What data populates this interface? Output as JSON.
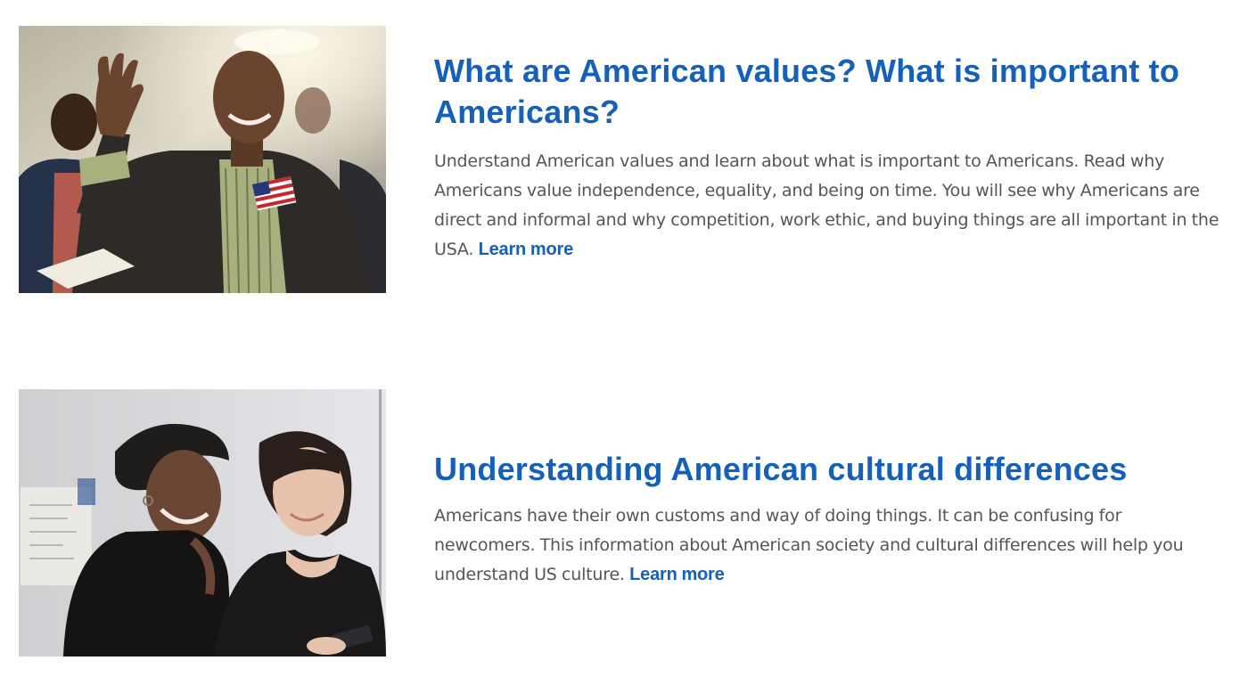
{
  "articles": [
    {
      "title": "What are American values? What is important to Americans?",
      "description": "Understand American values and learn about what is important to Americans. Read why Americans value independence, equality, and being on time. You will see why Americans are direct and informal and why competition, work ethic, and buying things are all important in the USA.",
      "link_label": "Learn more",
      "image": "photo-man-raising-hand-with-american-flag"
    },
    {
      "title": "Understanding American cultural differences",
      "description": "Americans have their own customs and way of doing things. It can be confusing for newcomers. This information about American society and cultural differences will help you understand US culture.",
      "link_label": "Learn more",
      "image": "photo-two-women-looking-at-phone"
    }
  ],
  "colors": {
    "accent": "#1560b8",
    "body_text": "#555555",
    "background": "#ffffff"
  }
}
